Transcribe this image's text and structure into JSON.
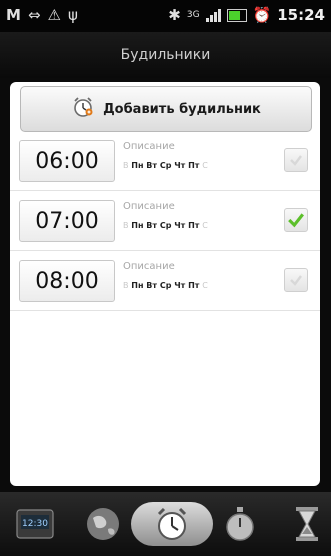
{
  "status_bar": {
    "time": "15:24",
    "left_icons": [
      "gmail-icon",
      "usb-sync-icon",
      "warning-icon",
      "usb-icon"
    ],
    "right_icons": [
      "bluetooth-icon",
      "hspa-icon",
      "signal-icon",
      "battery-icon",
      "alarm-clock-icon"
    ]
  },
  "header": {
    "title": "Будильники"
  },
  "add_alarm": {
    "label": "Добавить будильник"
  },
  "alarms": [
    {
      "time": "06:00",
      "description": "Описание",
      "days_prefix": "В",
      "days": "Пн Вт Ср Чт Пт",
      "days_suffix": "С",
      "enabled": false
    },
    {
      "time": "07:00",
      "description": "Описание",
      "days_prefix": "В",
      "days": "Пн Вт Ср Чт Пт",
      "days_suffix": "С",
      "enabled": true
    },
    {
      "time": "08:00",
      "description": "Описание",
      "days_prefix": "В",
      "days": "Пн Вт Ср Чт Пт",
      "days_suffix": "С",
      "enabled": false
    }
  ],
  "bottom_tabs": [
    {
      "name": "desk-clock-tab",
      "icon": "desk-clock-icon"
    },
    {
      "name": "world-clock-tab",
      "icon": "globe-icon"
    },
    {
      "name": "alarms-tab",
      "icon": "alarm-clock-icon",
      "active": true
    },
    {
      "name": "stopwatch-tab",
      "icon": "stopwatch-icon"
    },
    {
      "name": "timer-tab",
      "icon": "hourglass-icon"
    }
  ],
  "colors": {
    "check_green": "#5cbf2a",
    "panel": "#ffffff",
    "background": "#0b0b0b"
  }
}
